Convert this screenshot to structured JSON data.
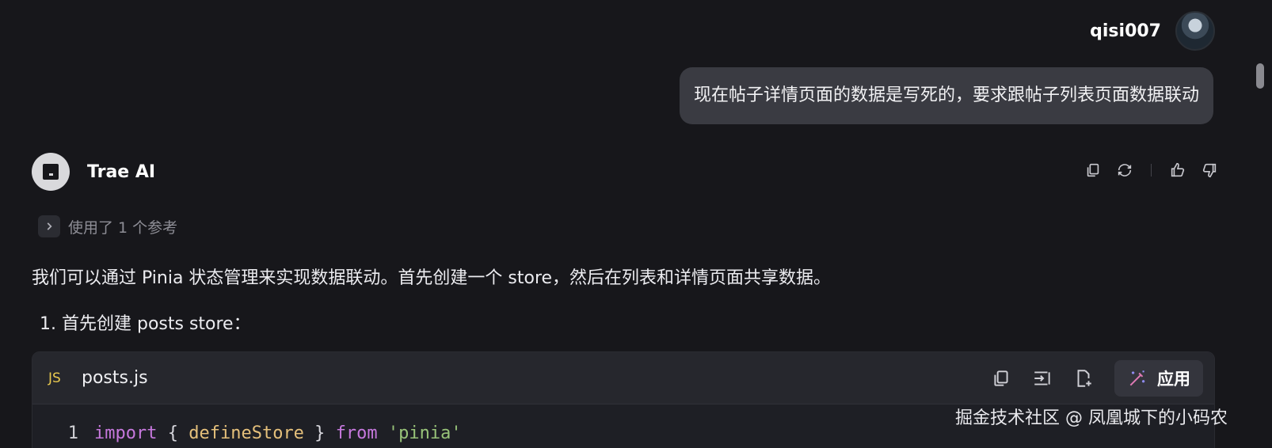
{
  "user": {
    "name": "qisi007"
  },
  "user_message": "现在帖子详情页面的数据是写死的，要求跟帖子列表页面数据联动",
  "assistant": {
    "name": "Trae AI"
  },
  "message_actions": [
    "copy-icon",
    "regenerate-icon",
    "thumbs-up-icon",
    "thumbs-down-icon"
  ],
  "references": {
    "label": "使用了 1 个参考"
  },
  "response": {
    "paragraph": "我们可以通过 Pinia 状态管理来实现数据联动。首先创建一个 store，然后在列表和详情页面共享数据。",
    "step_1": "1. 首先创建 posts store："
  },
  "code_block": {
    "language_badge": "JS",
    "file_name": "posts.js",
    "apply_label": "应用",
    "lines": [
      {
        "number": "1",
        "tokens": [
          "import",
          " { ",
          "defineStore",
          " } ",
          "from",
          " ",
          "'pinia'"
        ]
      }
    ]
  },
  "watermark": "掘金技术社区 @ 凤凰城下的小码农",
  "colors": {
    "background": "#17171b",
    "bubble": "#3a3b42",
    "keyword": "#c678dd",
    "function": "#e5c07b",
    "string": "#98c379",
    "js_badge": "#e8c84f"
  }
}
